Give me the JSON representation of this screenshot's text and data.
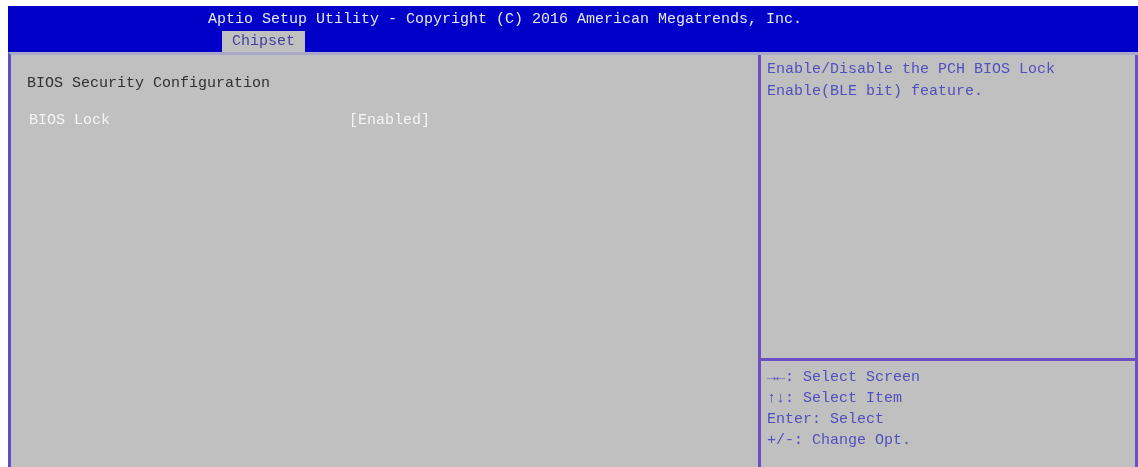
{
  "header": {
    "title": "Aptio Setup Utility - Copyright (C) 2016 American Megatrends, Inc."
  },
  "tabs": [
    {
      "label": "Chipset",
      "selected": true
    }
  ],
  "main": {
    "heading": "BIOS Security Configuration",
    "items": [
      {
        "label": "BIOS Lock",
        "value": "[Enabled]",
        "selected": true
      }
    ]
  },
  "help": {
    "text": "Enable/Disable the PCH BIOS Lock Enable(BLE bit) feature."
  },
  "keys": [
    "→←: Select Screen",
    "↑↓: Select Item",
    "Enter: Select",
    "+/-: Change Opt."
  ]
}
